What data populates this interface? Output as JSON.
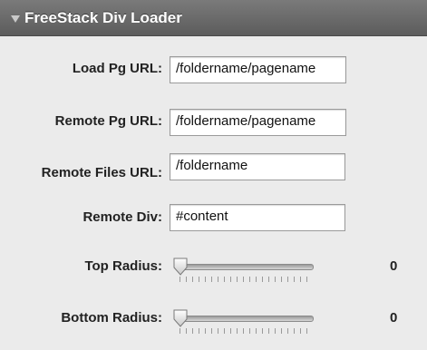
{
  "panel": {
    "title": "FreeStack Div Loader"
  },
  "fields": [
    {
      "label": "Load Pg URL:",
      "value": "/foldername/pagename"
    },
    {
      "label": "Remote Pg URL:",
      "value": "/foldername/pagename"
    },
    {
      "label": "Remote Files URL:",
      "value": "/foldername"
    },
    {
      "label": "Remote Div:",
      "value": "#content"
    }
  ],
  "sliders": [
    {
      "label": "Top Radius:",
      "value": "0"
    },
    {
      "label": "Bottom Radius:",
      "value": "0"
    }
  ],
  "icons": {
    "disclosure": "disclosure-triangle-icon"
  }
}
